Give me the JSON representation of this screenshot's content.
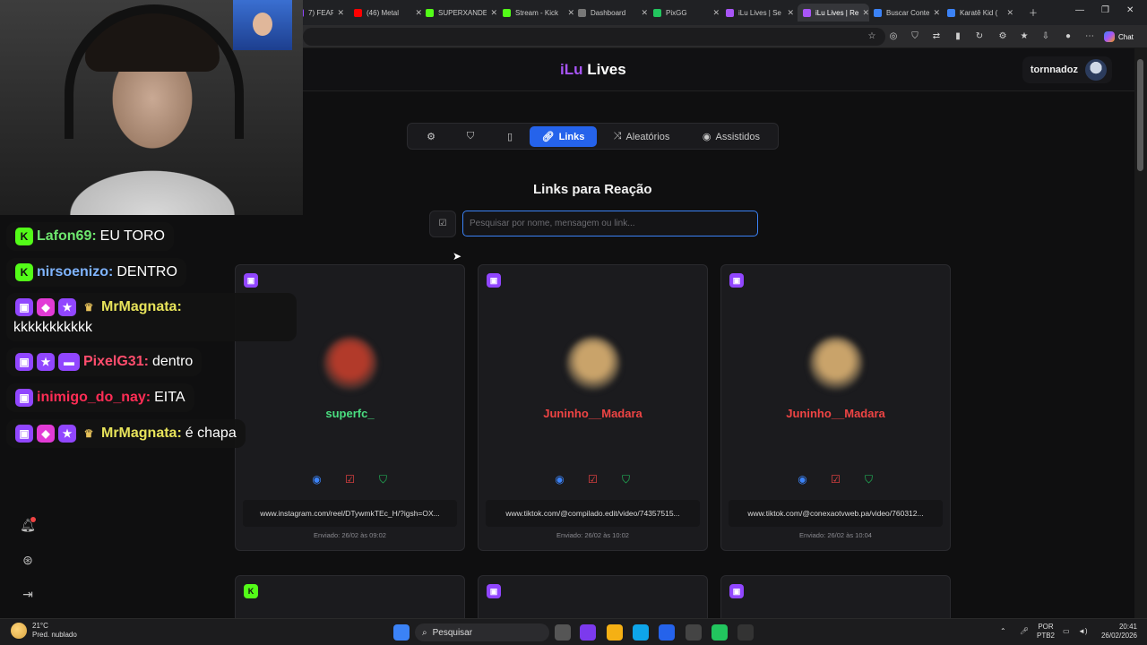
{
  "browser": {
    "tabs": [
      {
        "label": "7) FEAR.T",
        "fav": "#9146ff"
      },
      {
        "label": "(46) Metal",
        "fav": "#ff0000"
      },
      {
        "label": "SUPERXANDE",
        "fav": "#53fc18"
      },
      {
        "label": "Stream - Kick",
        "fav": "#53fc18"
      },
      {
        "label": "Dashboard",
        "fav": "#777777"
      },
      {
        "label": "PixGG",
        "fav": "#22c55e"
      },
      {
        "label": "iLu Lives | Se",
        "fav": "#a855f7"
      },
      {
        "label": "iLu Lives | Re",
        "fav": "#a855f7"
      },
      {
        "label": "Buscar Conte",
        "fav": "#3b82f6"
      },
      {
        "label": "Karatê Kid (",
        "fav": "#3b82f6"
      }
    ],
    "chat_label": "Chat"
  },
  "chat": [
    {
      "badges": [
        "kick"
      ],
      "user": "Lafon69:",
      "user_color": "#6ee76e",
      "text": "EU TORO"
    },
    {
      "badges": [
        "kick"
      ],
      "user": "nirsoenizo:",
      "user_color": "#7fb4ff",
      "text": "DENTRO"
    },
    {
      "badges": [
        "twitch",
        "gem",
        "star",
        "wing"
      ],
      "user": "MrMagnata:",
      "user_color": "#e7e35a",
      "text": "kkkkkkkkkkk"
    },
    {
      "badges": [
        "twitch",
        "star",
        "bot"
      ],
      "user": "PixelG31:",
      "user_color": "#ff4d6d",
      "text": "dentro"
    },
    {
      "badges": [
        "twitch"
      ],
      "user": "inimigo_do_nay:",
      "user_color": "#ff2d55",
      "text": "EITA"
    },
    {
      "badges": [
        "twitch",
        "gem",
        "star",
        "wing"
      ],
      "user": "MrMagnata:",
      "user_color": "#e7e35a",
      "text": "é chapa"
    }
  ],
  "app": {
    "brand_i": "iLu",
    "brand_rest": " Lives",
    "username": "tornnadoz",
    "nav": {
      "links": "Links",
      "random": "Aleatórios",
      "watched": "Assistidos"
    },
    "title": "Links para Reação",
    "search_placeholder": "Pesquisar por nome, mensagem ou link..."
  },
  "cards": [
    {
      "platform": "twitch",
      "name": "superfc_",
      "name_color": "#4ade80",
      "link": "www.instagram.com/reel/DTywmkTEc_H/?igsh=OX...",
      "sent": "Enviado: 26/02 às 09:02",
      "pic": "#b23a2a"
    },
    {
      "platform": "twitch",
      "name": "Juninho__Madara",
      "name_color": "#ef4444",
      "link": "www.tiktok.com/@compilado.edit/video/74357515...",
      "sent": "Enviado: 26/02 às 10:02",
      "pic": "#c9a36a"
    },
    {
      "platform": "twitch",
      "name": "Juninho__Madara",
      "name_color": "#ef4444",
      "link": "www.tiktok.com/@conexaotvweb.pa/video/760312...",
      "sent": "Enviado: 26/02 às 10:04",
      "pic": "#c9a36a"
    }
  ],
  "cards_partial": [
    {
      "platform": "kick"
    },
    {
      "platform": "twitch"
    },
    {
      "platform": "twitch"
    }
  ],
  "taskbar": {
    "temp": "21°C",
    "weather": "Pred. nublado",
    "search": "Pesquisar",
    "lang1": "POR",
    "lang2": "PTB2",
    "time": "20:41",
    "date": "26/02/2026"
  }
}
